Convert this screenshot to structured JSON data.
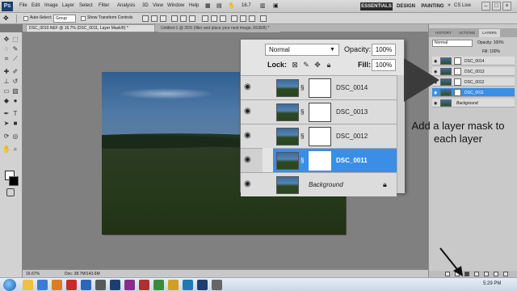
{
  "menubar": {
    "logo": "Ps",
    "items": [
      "File",
      "Edit",
      "Image",
      "Layer",
      "Select",
      "Filter",
      "Analysis",
      "3D",
      "View",
      "Window",
      "Help"
    ],
    "zoom": "16.7",
    "workspaces": [
      "ESSENTIALS",
      "DESIGN",
      "PAINTING"
    ],
    "cslive": "CS Live"
  },
  "options": {
    "autoselect": "Auto-Select:",
    "group": "Group",
    "transform": "Show Transform Controls"
  },
  "tabs": {
    "active": "DSC_0010.NEF @ 16.7% (DSC_0011, Layer Mask/8) *",
    "inactive": "Untitled-1 @ 26% (filler and place your next image, RGB/8) *"
  },
  "status": {
    "zoom": "16.67%",
    "doc": "Doc: 38.7M/143.6M"
  },
  "panel_tabs": [
    "HISTORY",
    "ACTIONS",
    "LAYERS"
  ],
  "mini_layers": {
    "blend": "Normal",
    "opacity": "Opacity: 100%",
    "fill": "Fill: 100%",
    "rows": [
      "DSC_0014",
      "DSC_0013",
      "DSC_0012",
      "DSC_0011",
      "Background"
    ]
  },
  "zoom_panel": {
    "blend": "Normal",
    "opacity_label": "Opacity:",
    "opacity": "100%",
    "lock_label": "Lock:",
    "fill_label": "Fill:",
    "fill": "100%",
    "layers": [
      {
        "name": "DSC_0014",
        "selected": false
      },
      {
        "name": "DSC_0013",
        "selected": false
      },
      {
        "name": "DSC_0012",
        "selected": false
      },
      {
        "name": "DSC_0011",
        "selected": true
      }
    ],
    "background": "Background"
  },
  "annotation": "Add a layer mask to each layer",
  "taskbar": {
    "clock": "5:29 PM"
  },
  "colors": {
    "selection": "#3a8ee6",
    "accent_dark": "#2a2a2a"
  }
}
